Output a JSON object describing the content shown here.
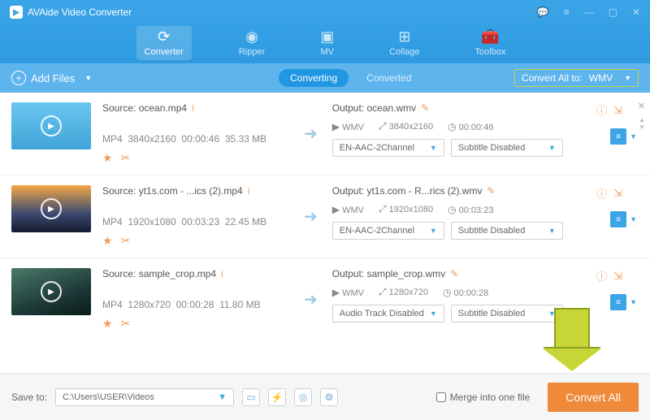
{
  "app": {
    "title": "AVAide Video Converter"
  },
  "tabs": {
    "converter": "Converter",
    "ripper": "Ripper",
    "mv": "MV",
    "collage": "Collage",
    "toolbox": "Toolbox"
  },
  "subbar": {
    "add_files": "Add Files",
    "converting": "Converting",
    "converted": "Converted",
    "convert_all_to_label": "Convert All to:",
    "convert_all_to_format": "WMV"
  },
  "items": [
    {
      "source": "Source: ocean.mp4",
      "fmt": "MP4",
      "res": "3840x2160",
      "dur": "00:00:46",
      "size": "35.33 MB",
      "output": "Output: ocean.wmv",
      "out_fmt": "WMV",
      "out_res": "3840x2160",
      "out_dur": "00:00:46",
      "audio": "EN-AAC-2Channel",
      "subtitle": "Subtitle Disabled"
    },
    {
      "source": "Source: yt1s.com - ...ics (2).mp4",
      "fmt": "MP4",
      "res": "1920x1080",
      "dur": "00:03:23",
      "size": "22.45 MB",
      "output": "Output: yt1s.com - R...rics (2).wmv",
      "out_fmt": "WMV",
      "out_res": "1920x1080",
      "out_dur": "00:03:23",
      "audio": "EN-AAC-2Channel",
      "subtitle": "Subtitle Disabled"
    },
    {
      "source": "Source: sample_crop.mp4",
      "fmt": "MP4",
      "res": "1280x720",
      "dur": "00:00:28",
      "size": "11.80 MB",
      "output": "Output: sample_crop.wmv",
      "out_fmt": "WMV",
      "out_res": "1280x720",
      "out_dur": "00:00:28",
      "audio": "Audio Track Disabled",
      "subtitle": "Subtitle Disabled"
    }
  ],
  "footer": {
    "save_to_label": "Save to:",
    "path": "C:\\Users\\USER\\Videos",
    "merge_label": "Merge into one file",
    "convert_all": "Convert All"
  }
}
